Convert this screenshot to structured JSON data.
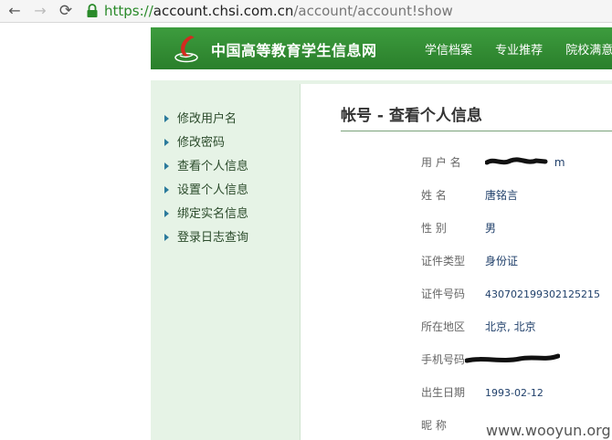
{
  "browser": {
    "url_scheme": "https://",
    "url_host": "account.chsi.com.cn",
    "url_path": "/account/account!show",
    "back_glyph": "←",
    "forward_glyph": "→",
    "reload_glyph": "⟳"
  },
  "header": {
    "site_title": "中国高等教育学生信息网",
    "nav": [
      "学信档案",
      "专业推荐",
      "院校满意"
    ]
  },
  "sidebar": {
    "items": [
      "修改用户名",
      "修改密码",
      "查看个人信息",
      "设置个人信息",
      "绑定实名信息",
      "登录日志查询"
    ]
  },
  "panel": {
    "title": "帐号 - 查看个人信息",
    "rows": [
      {
        "label": "用 户 名",
        "value": "m"
      },
      {
        "label": "姓    名",
        "value": "唐铭言"
      },
      {
        "label": "性    别",
        "value": "男"
      },
      {
        "label": "证件类型",
        "value": "身份证"
      },
      {
        "label": "证件号码",
        "value": "430702199302125215"
      },
      {
        "label": "所在地区",
        "value": "北京, 北京"
      },
      {
        "label": "手机号码",
        "value": ""
      },
      {
        "label": "出生日期",
        "value": "1993-02-12"
      },
      {
        "label": "昵    称",
        "value": ""
      }
    ]
  },
  "watermark": "www.wooyun.org",
  "colors": {
    "header_green": "#2f8a30",
    "band_green": "#e6f3e6"
  }
}
